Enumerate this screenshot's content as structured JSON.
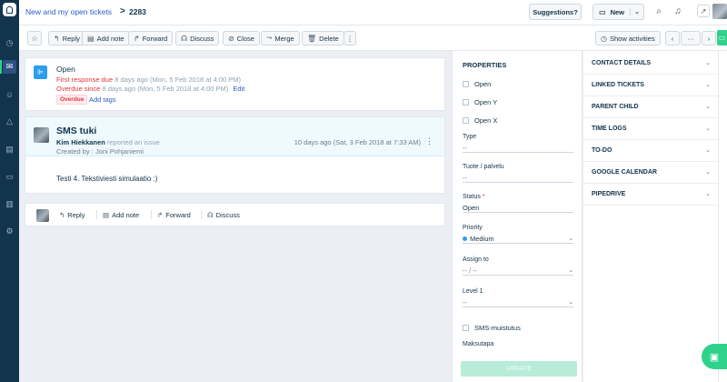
{
  "header": {
    "breadcrumb": "New and my open tickets",
    "separator": ">",
    "ticket_id": "2283",
    "suggestions_label": "Suggestions?",
    "new_label": "New"
  },
  "toolbar": {
    "reply": "Reply",
    "add_note": "Add note",
    "forward": "Forward",
    "discuss": "Discuss",
    "close": "Close",
    "merge": "Merge",
    "delete": "Delete",
    "more": "⋮",
    "show_activities": "Show activities",
    "prev": "‹",
    "dots": "···",
    "next": "›"
  },
  "status": {
    "title": "Open",
    "first_response_label": "First response due",
    "first_response_value": "8 days ago (Mon, 5 Feb 2018 at 4:00 PM)",
    "overdue_label": "Overdue since",
    "overdue_value": "8 days ago (Mon, 5 Feb 2018 at 4:00 PM)",
    "edit": "Edit",
    "badge": "Overdue",
    "add_tags": "Add tags"
  },
  "conversation": {
    "title": "SMS tuki",
    "author": "Kim Hiekkanen",
    "action": "reported an issue",
    "created_by": "Created by : Joni Pohjaniemi",
    "timestamp": "10 days ago (Sat, 3 Feb 2018 at 7:33 AM)",
    "body": "Testi 4. Tekstiviesti simulaatio :)"
  },
  "reply_bar": {
    "reply": "Reply",
    "add_note": "Add note",
    "forward": "Forward",
    "discuss": "Discuss"
  },
  "properties": {
    "title": "PROPERTIES",
    "checks": [
      "Open",
      "Open Y",
      "Open X"
    ],
    "type_label": "Type",
    "type_value": "--",
    "tuote_label": "Tuote / palvelu",
    "tuote_value": "--",
    "status_label": "Status",
    "status_required": "*",
    "status_value": "Open",
    "priority_label": "Priority",
    "priority_value": "Medium",
    "assign_label": "Assign to",
    "assign_value": "-- / --",
    "level_label": "Level 1",
    "level_value": "--",
    "sms_label": "SMS-muistutus",
    "maksutapa_label": "Maksutapa",
    "update": "UPDATE"
  },
  "right_panel": {
    "items": [
      "CONTACT DETAILS",
      "LINKED TICKETS",
      "PARENT CHILD",
      "TIME LOGS",
      "TO-DO",
      "GOOGLE CALENDAR",
      "PIPEDRIVE"
    ]
  },
  "colors": {
    "sidebar": "#12344d",
    "accent_green": "#2fd28a",
    "link_blue": "#2c5cc5",
    "overdue_red": "#e43538",
    "conversation_bg": "#eefafe",
    "status_icon_blue": "#2c9eef"
  }
}
